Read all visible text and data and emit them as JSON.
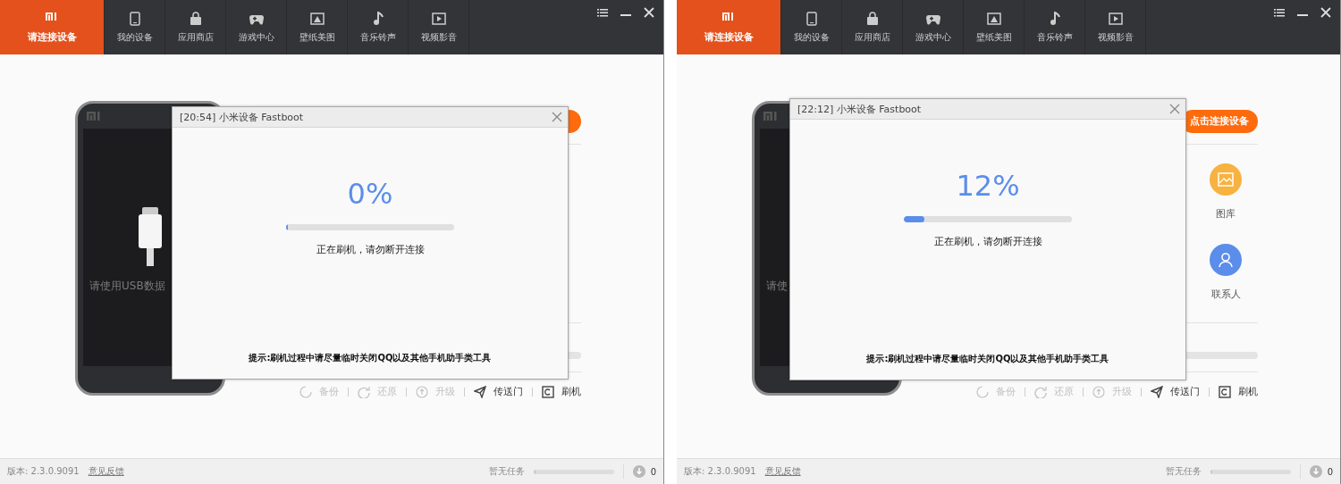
{
  "panels": [
    {
      "nav": {
        "tabs": [
          {
            "label": "请连接设备",
            "selected": true
          },
          {
            "label": "我的设备",
            "selected": false
          },
          {
            "label": "应用商店",
            "selected": false
          },
          {
            "label": "游戏中心",
            "selected": false
          },
          {
            "label": "壁纸美图",
            "selected": false
          },
          {
            "label": "音乐铃声",
            "selected": false
          },
          {
            "label": "视频影音",
            "selected": false
          }
        ]
      },
      "device": {
        "caption": "请使用USB数据"
      },
      "toolbar": [
        {
          "label": "备份",
          "disabled": true
        },
        {
          "label": "还原",
          "disabled": true
        },
        {
          "label": "升级",
          "disabled": true
        },
        {
          "label": "传送门",
          "disabled": false
        },
        {
          "label": "刷机",
          "disabled": false
        }
      ],
      "dialog": {
        "title": "[20:54] 小米设备 Fastboot",
        "percent": "0%",
        "level": 0.01,
        "status": "正在刷机，请勿断开连接",
        "tip": "提示:刷机过程中请尽量临时关闭QQ以及其他手机助手类工具"
      },
      "status_bar": {
        "version": "版本: 2.3.0.9091",
        "feedback": "意见反馈",
        "tasks": "暂无任务",
        "level": 0,
        "downloads": "0"
      }
    },
    {
      "nav": {
        "tabs": [
          {
            "label": "请连接设备",
            "selected": true
          },
          {
            "label": "我的设备",
            "selected": false
          },
          {
            "label": "应用商店",
            "selected": false
          },
          {
            "label": "游戏中心",
            "selected": false
          },
          {
            "label": "壁纸美图",
            "selected": false
          },
          {
            "label": "音乐铃声",
            "selected": false
          },
          {
            "label": "视频影音",
            "selected": false
          }
        ]
      },
      "device": {
        "caption": "请使"
      },
      "connect_button": {
        "label": "点击连接设备"
      },
      "shortcuts": [
        {
          "label": "图库",
          "color": "#f7b23f"
        },
        {
          "label": "联系人",
          "color": "#5b8eea"
        }
      ],
      "toolbar": [
        {
          "label": "备份",
          "disabled": true
        },
        {
          "label": "还原",
          "disabled": true
        },
        {
          "label": "升级",
          "disabled": true
        },
        {
          "label": "传送门",
          "disabled": false
        },
        {
          "label": "刷机",
          "disabled": false
        }
      ],
      "dialog": {
        "title": "[22:12] 小米设备 Fastboot",
        "percent": "12%",
        "level": 0.12,
        "status": "正在刷机，请勿断开连接",
        "tip": "提示:刷机过程中请尽量临时关闭QQ以及其他手机助手类工具"
      },
      "status_bar": {
        "version": "版本: 2.3.0.9091",
        "feedback": "意见反馈",
        "tasks": "暂无任务",
        "level": 0,
        "downloads": "0"
      }
    }
  ]
}
